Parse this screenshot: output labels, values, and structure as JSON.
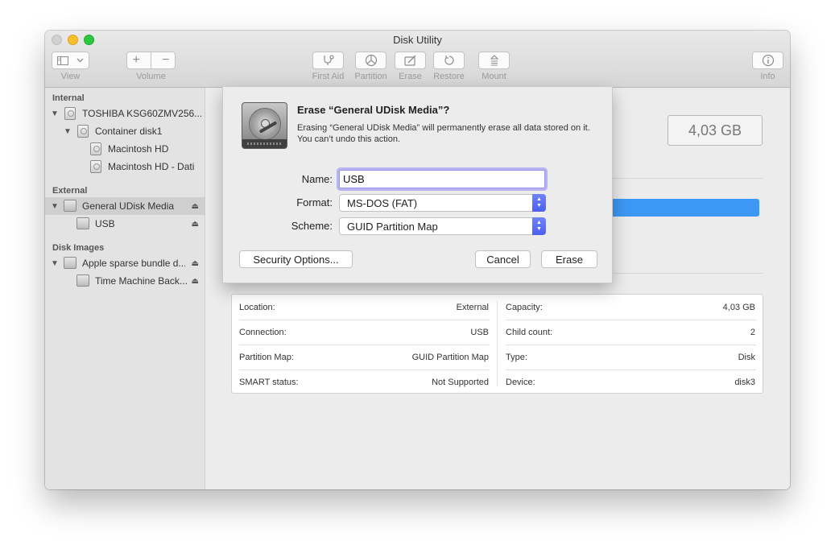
{
  "window": {
    "title": "Disk Utility"
  },
  "toolbar": {
    "view_label": "View",
    "volume_label": "Volume",
    "volume_add": "+",
    "volume_remove": "−",
    "first_aid_label": "First Aid",
    "partition_label": "Partition",
    "erase_label": "Erase",
    "restore_label": "Restore",
    "mount_label": "Mount",
    "info_label": "Info"
  },
  "sidebar": {
    "internal_header": "Internal",
    "external_header": "External",
    "disk_images_header": "Disk Images",
    "items": [
      {
        "label": "TOSHIBA KSG60ZMV256..."
      },
      {
        "label": "Container disk1"
      },
      {
        "label": "Macintosh HD"
      },
      {
        "label": "Macintosh HD - Dati"
      },
      {
        "label": "General UDisk Media"
      },
      {
        "label": "USB"
      },
      {
        "label": "Apple sparse bundle d..."
      },
      {
        "label": "Time Machine Back..."
      }
    ]
  },
  "main": {
    "capacity_display": "4,03 GB",
    "info": {
      "location_label": "Location:",
      "location_value": "External",
      "connection_label": "Connection:",
      "connection_value": "USB",
      "partition_map_label": "Partition Map:",
      "partition_map_value": "GUID Partition Map",
      "smart_label": "SMART status:",
      "smart_value": "Not Supported",
      "capacity_label": "Capacity:",
      "capacity_value": "4,03 GB",
      "child_count_label": "Child count:",
      "child_count_value": "2",
      "type_label": "Type:",
      "type_value": "Disk",
      "device_label": "Device:",
      "device_value": "disk3"
    }
  },
  "dialog": {
    "title": "Erase “General UDisk Media”?",
    "message": "Erasing “General UDisk Media” will permanently erase all data stored on it. You can’t undo this action.",
    "name_label": "Name:",
    "name_value": "USB",
    "format_label": "Format:",
    "format_value": "MS-DOS (FAT)",
    "scheme_label": "Scheme:",
    "scheme_value": "GUID Partition Map",
    "security_button": "Security Options...",
    "cancel_button": "Cancel",
    "erase_button": "Erase"
  }
}
